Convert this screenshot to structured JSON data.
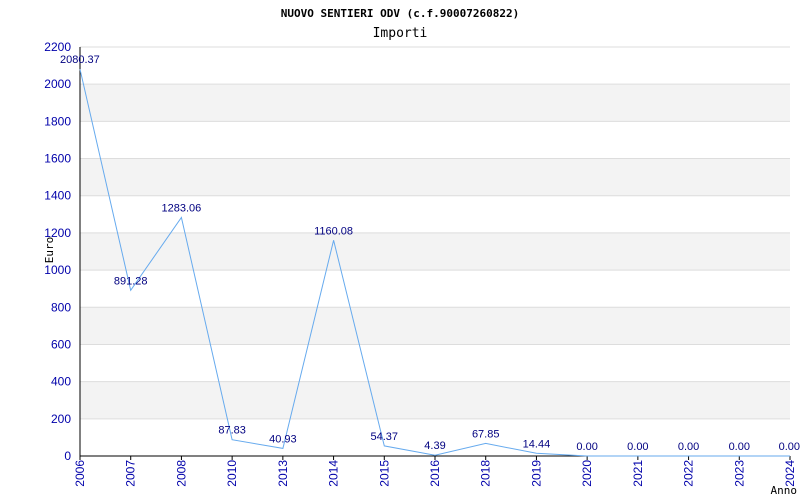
{
  "chart_data": {
    "type": "line",
    "title": "NUOVO SENTIERI ODV (c.f.90007260822)",
    "subtitle": "Importi",
    "ylabel": "Euro",
    "xlabel": "Anno",
    "ylim": [
      0,
      2200
    ],
    "yticks": [
      "0",
      "200",
      "400",
      "600",
      "800",
      "1000",
      "1200",
      "1400",
      "1600",
      "1800",
      "2000",
      "2200"
    ],
    "categories": [
      "2006",
      "2007",
      "2008",
      "2010",
      "2013",
      "2014",
      "2015",
      "2016",
      "2018",
      "2019",
      "2020",
      "2021",
      "2022",
      "2023",
      "2024"
    ],
    "values": [
      2080.37,
      891.28,
      1283.06,
      87.83,
      40.93,
      1160.08,
      54.37,
      4.39,
      67.85,
      14.44,
      0.0,
      0.0,
      0.0,
      0.0,
      0.0
    ],
    "value_labels": [
      "2080.37",
      "891.28",
      "1283.06",
      "87.83",
      "40.93",
      "1160.08",
      "54.37",
      "4.39",
      "67.85",
      "14.44",
      "0.00",
      "0.00",
      "0.00",
      "0.00",
      "0.00"
    ],
    "grid": true,
    "colors": {
      "line": "#66aaee",
      "band": "#f3f3f3",
      "tick_text": "#0000aa",
      "label_text": "#000080"
    }
  }
}
